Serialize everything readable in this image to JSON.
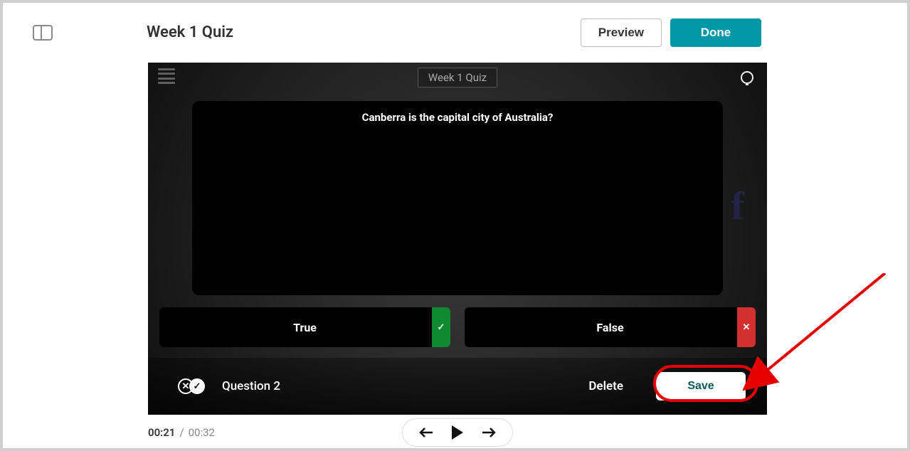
{
  "header": {
    "title": "Week 1 Quiz",
    "preview_label": "Preview",
    "done_label": "Done"
  },
  "stage": {
    "title": "Week 1 Quiz",
    "question_text": "Canberra is the capital city of Australia?",
    "answers": {
      "true_label": "True",
      "false_label": "False"
    },
    "question_number_label": "Question 2",
    "delete_label": "Delete",
    "save_label": "Save"
  },
  "playback": {
    "current_time": "00:21",
    "duration": "00:32"
  },
  "colors": {
    "primary": "#0097a7",
    "correct": "#0f8a2f",
    "incorrect": "#d32f2f",
    "annotation": "#e60000"
  }
}
